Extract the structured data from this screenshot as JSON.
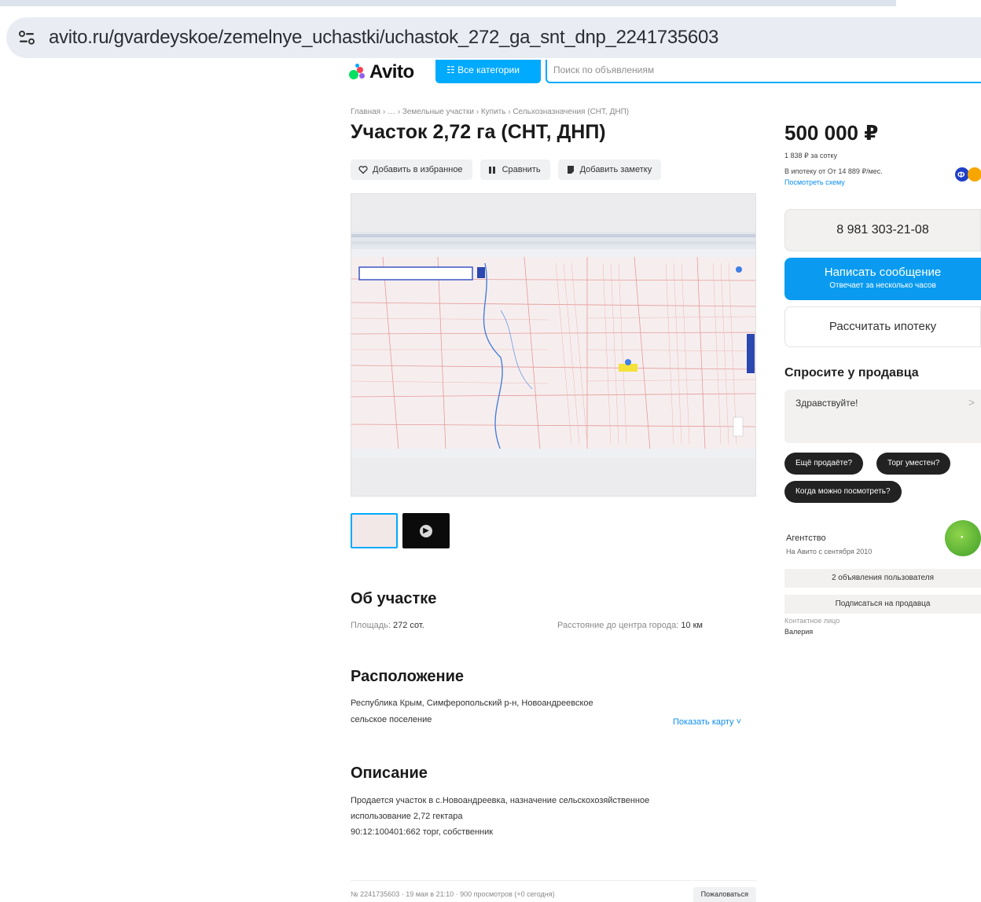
{
  "browser": {
    "url": "avito.ru/gvardeyskoe/zemelnye_uchastki/uchastok_272_ga_snt_dnp_2241735603"
  },
  "header": {
    "logo": "Avito",
    "all_categories": "Все категории",
    "search_placeholder": "Поиск по объявлениям"
  },
  "listing": {
    "breadcrumb": "Главная › … › Земельные участки › Купить › Сельхозназначения (СНТ, ДНП)",
    "title": "Участок 2,72 га (СНТ, ДНП)",
    "actions": {
      "favorite": "Добавить в избранное",
      "compare": "Сравнить",
      "note": "Добавить заметку"
    },
    "about": {
      "title": "Об участке",
      "area_label": "Площадь:",
      "area_value": "272 сот.",
      "distance_label": "Расстояние до центра города:",
      "distance_value": "10 км"
    },
    "location": {
      "title": "Расположение",
      "line1": "Республика Крым, Симферопольский р-н, Новоандреевское",
      "line2": "сельское поселение",
      "show_map": "Показать карту ˅"
    },
    "description": {
      "title": "Описание",
      "line1": "Продается участок в с.Новоандреевка, назначение сельскохозяйственное",
      "line2": "использование 2,72 гектара",
      "line3": "90:12:100401:662 торг, собственник"
    },
    "footer": {
      "meta": "№ 2241735603 · 19 мая в 21:10 · 900 просмотров (+0 сегодня)",
      "complain": "Пожаловаться"
    }
  },
  "sidebar": {
    "price": "500 000 ₽",
    "price_per_unit": "1 838 ₽ за сотку",
    "mortgage_from": "В ипотеку от От 14 889 ₽/мес.",
    "schedule_link": "Посмотреть схему",
    "phone": "8 981 303-21-08",
    "message_main": "Написать сообщение",
    "message_sub": "Отвечает за несколько часов",
    "calc_mortgage": "Рассчитать ипотеку",
    "ask_title": "Спросите у продавца",
    "ask_placeholder": "Здравствуйте!",
    "chips": [
      "Ещё продаёте?",
      "Торг уместен?",
      "Когда можно посмотреть?"
    ],
    "seller_type": "Агентство",
    "seller_since": "На Авито с сентября 2010",
    "seller_ads": "2 объявления пользователя",
    "subscribe": "Подписаться на продавца",
    "contact_label": "Контактное лицо",
    "contact_name": "Валерия"
  },
  "colors": {
    "accent": "#00aaff",
    "primary_button": "#0a9bf0",
    "chip": "#222222"
  }
}
